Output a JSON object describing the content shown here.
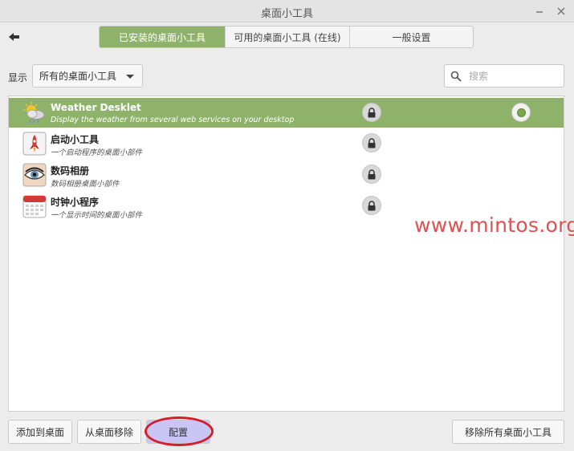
{
  "window": {
    "title": "桌面小工具"
  },
  "tabs": [
    {
      "label": "已安装的桌面小工具",
      "active": true
    },
    {
      "label": "可用的桌面小工具 (在线)",
      "active": false
    },
    {
      "label": "一般设置",
      "active": false
    }
  ],
  "filter": {
    "label": "显示",
    "selected": "所有的桌面小工具"
  },
  "search": {
    "placeholder": "搜索",
    "value": ""
  },
  "desklets": [
    {
      "name": "Weather Desklet",
      "description": "Display the weather from several web services on your desktop",
      "icon": "weather-icon",
      "locked": true,
      "selected": true,
      "active": true
    },
    {
      "name": "启动小工具",
      "description": "一个启动程序的桌面小部件",
      "icon": "launcher-rocket-icon",
      "locked": true,
      "selected": false,
      "active": false
    },
    {
      "name": "数码相册",
      "description": "数码相册桌面小部件",
      "icon": "photo-frame-eye-icon",
      "locked": true,
      "selected": false,
      "active": false
    },
    {
      "name": "时钟小程序",
      "description": "一个显示时间的桌面小部件",
      "icon": "calendar-clock-icon",
      "locked": true,
      "selected": false,
      "active": false
    }
  ],
  "watermark": "www.mintos.org",
  "buttons": {
    "add": "添加到桌面",
    "remove": "从桌面移除",
    "configure": "配置",
    "remove_all": "移除所有桌面小工具"
  },
  "colors": {
    "accent": "#8fb26a",
    "highlight": "#d21f2a",
    "configure_button": "#c9c5f4",
    "watermark": "#e05050"
  }
}
